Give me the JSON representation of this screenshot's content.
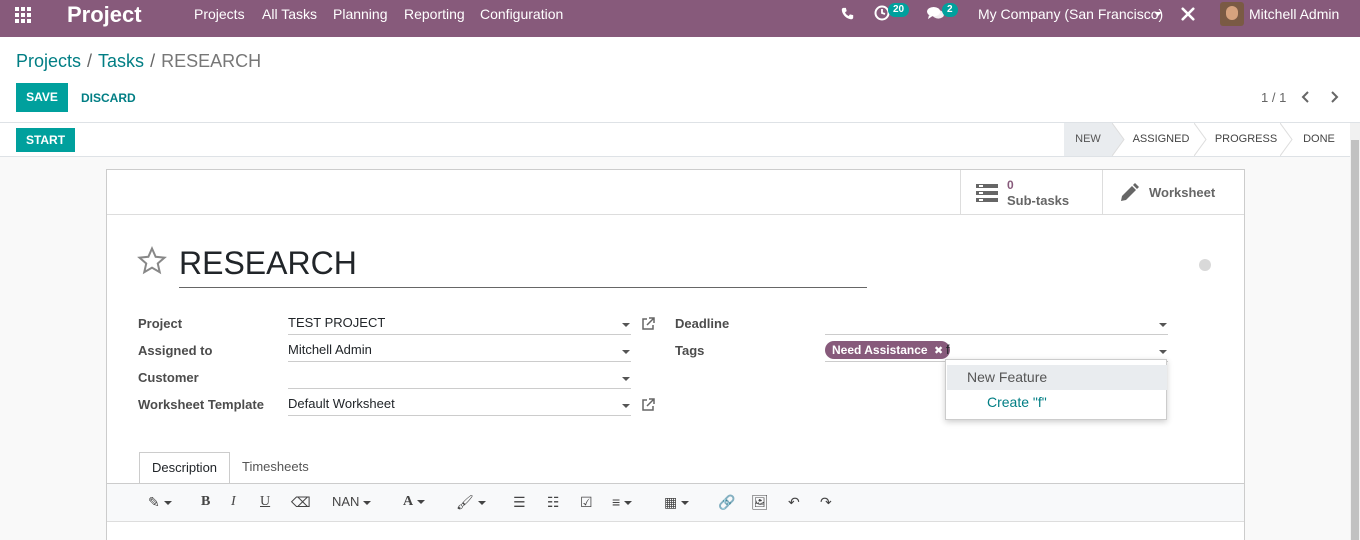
{
  "navbar": {
    "brand": "Project",
    "menu": [
      "Projects",
      "All Tasks",
      "Planning",
      "Reporting",
      "Configuration"
    ],
    "activity_count": "20",
    "message_count": "2",
    "company": "My Company (San Francisco)",
    "user": "Mitchell Admin",
    "icons": [
      "apps-grid-icon",
      "phone-icon",
      "activity-clock-icon",
      "chat-bubbles-icon",
      "caret-down-icon",
      "tools-icon",
      "avatar"
    ]
  },
  "breadcrumb": [
    "Projects",
    "Tasks",
    "RESEARCH"
  ],
  "buttons": {
    "save": "SAVE",
    "discard": "DISCARD",
    "start": "START"
  },
  "pager": {
    "value": "1 / 1"
  },
  "stages": [
    "NEW",
    "ASSIGNED",
    "PROGRESS",
    "DONE"
  ],
  "active_stage": "NEW",
  "smart_buttons": {
    "subtasks_count": "0",
    "subtasks_label": "Sub-tasks",
    "worksheet_label": "Worksheet"
  },
  "task": {
    "title": "RESEARCH"
  },
  "fields": {
    "project_label": "Project",
    "project_value": "TEST PROJECT",
    "assigned_label": "Assigned to",
    "assigned_value": "Mitchell Admin",
    "customer_label": "Customer",
    "customer_value": "",
    "template_label": "Worksheet Template",
    "template_value": "Default Worksheet",
    "deadline_label": "Deadline",
    "deadline_value": "",
    "tags_label": "Tags",
    "tag": "Need Assistance",
    "tags_input": "f"
  },
  "autocomplete": {
    "option": "New Feature",
    "create": "Create \"f\""
  },
  "tabs": [
    "Description",
    "Timesheets"
  ],
  "editor_toolbar": {
    "style_select": "NAN"
  },
  "colors": {
    "brand": "#875a7b",
    "accent": "#00a09d",
    "link": "#017e84"
  }
}
